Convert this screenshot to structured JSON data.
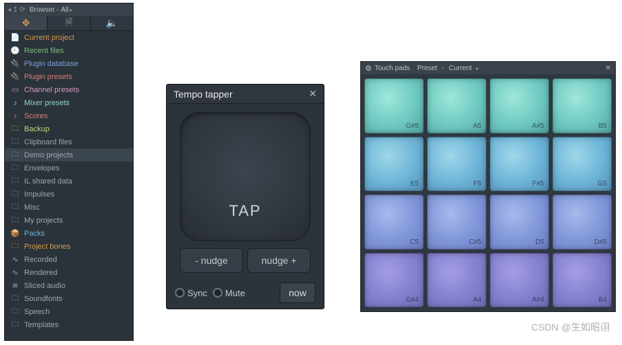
{
  "browser": {
    "title_prefix": "Browser",
    "title_scope": "All",
    "toolbar": [
      "crosshair-icon",
      "clipboard-icon",
      "speaker-icon"
    ],
    "items": [
      {
        "label": "Current project",
        "icon": "📄",
        "color": "#d69a4c"
      },
      {
        "label": "Recent files",
        "icon": "🕘",
        "color": "#7fbf7f"
      },
      {
        "label": "Plugin database",
        "icon": "🔌",
        "color": "#7e9fd6"
      },
      {
        "label": "Plugin presets",
        "icon": "🔌",
        "color": "#d67e7e"
      },
      {
        "label": "Channel presets",
        "icon": "▭",
        "color": "#d69ac2"
      },
      {
        "label": "Mixer presets",
        "icon": "♪",
        "color": "#8fd6c2"
      },
      {
        "label": "Scores",
        "icon": "♪",
        "color": "#d67e7e"
      },
      {
        "label": "Backup",
        "icon": "🗀",
        "color": "#c2d67e"
      },
      {
        "label": "Clipboard files",
        "icon": "🗀",
        "color": "#9fa6ad"
      },
      {
        "label": "Demo projects",
        "icon": "🗀",
        "color": "#9fa6ad",
        "selected": true
      },
      {
        "label": "Envelopes",
        "icon": "🗀",
        "color": "#9fa6ad"
      },
      {
        "label": "IL shared data",
        "icon": "🗀",
        "color": "#9fa6ad"
      },
      {
        "label": "Impulses",
        "icon": "🗀",
        "color": "#9fa6ad"
      },
      {
        "label": "Misc",
        "icon": "🗀",
        "color": "#9fa6ad"
      },
      {
        "label": "My projects",
        "icon": "🗀",
        "color": "#9fa6ad"
      },
      {
        "label": "Packs",
        "icon": "📦",
        "color": "#6fb7d6"
      },
      {
        "label": "Project bones",
        "icon": "🗀",
        "color": "#d69a4c"
      },
      {
        "label": "Recorded",
        "icon": "∿",
        "color": "#9fa6ad"
      },
      {
        "label": "Rendered",
        "icon": "∿",
        "color": "#9fa6ad"
      },
      {
        "label": "Sliced audio",
        "icon": "≋",
        "color": "#9fa6ad"
      },
      {
        "label": "Soundfonts",
        "icon": "🗀",
        "color": "#9fa6ad"
      },
      {
        "label": "Speech",
        "icon": "🗀",
        "color": "#9fa6ad"
      },
      {
        "label": "Templates",
        "icon": "🗀",
        "color": "#9fa6ad"
      }
    ]
  },
  "tapper": {
    "title": "Tempo tapper",
    "tap_label": "TAP",
    "nudge_minus": "- nudge",
    "nudge_plus": "nudge +",
    "sync_label": "Sync",
    "mute_label": "Mute",
    "now_label": "now"
  },
  "touchpads": {
    "title_prefix": "Touch pads",
    "preset_label": "Preset",
    "preset_value": "Current",
    "pads": [
      [
        "G#5",
        "A5",
        "A#5",
        "B5"
      ],
      [
        "E5",
        "F5",
        "F#5",
        "G5"
      ],
      [
        "C5",
        "C#5",
        "D5",
        "D#5"
      ],
      [
        "G#4",
        "A4",
        "A#4",
        "B4"
      ]
    ]
  },
  "watermark": "CSDN @生如昭诩"
}
